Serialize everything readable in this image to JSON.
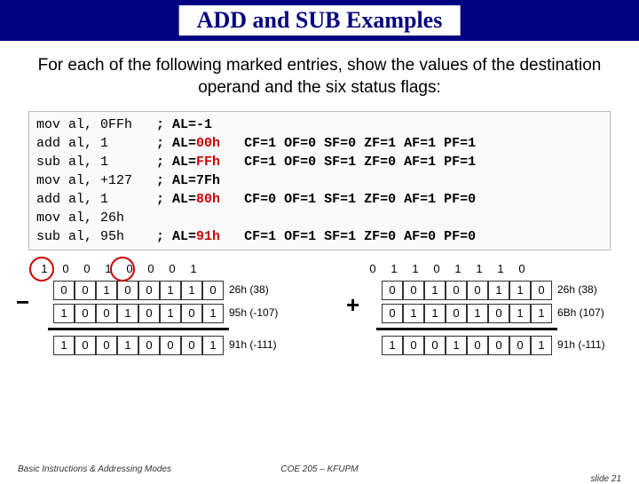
{
  "title": "ADD and SUB Examples",
  "subtitle": "For each of the following marked entries, show the values of the destination operand and the six status flags:",
  "code": [
    {
      "instr": "mov al, 0FFh",
      "comment": "; AL=-1",
      "flags": ""
    },
    {
      "instr": "add al, 1",
      "comment": "; AL=",
      "res": "00h",
      "flags": "   CF=1 OF=0 SF=0 ZF=1 AF=1 PF=1"
    },
    {
      "instr": "sub al, 1",
      "comment": "; AL=",
      "res": "FFh",
      "flags": "   CF=1 OF=0 SF=1 ZF=0 AF=1 PF=1"
    },
    {
      "instr": "mov al, +127",
      "comment": "; AL=7Fh",
      "flags": ""
    },
    {
      "instr": "add al, 1",
      "comment": "; AL=",
      "res": "80h",
      "flags": "   CF=0 OF=1 SF=1 ZF=0 AF=1 PF=0"
    },
    {
      "instr": "mov al, 26h",
      "comment": "",
      "flags": ""
    },
    {
      "instr": "sub al, 95h",
      "comment": "; AL=",
      "res": "91h",
      "flags": "   CF=1 OF=1 SF=1 ZF=0 AF=0 PF=0"
    }
  ],
  "left_calc": {
    "borrow": [
      "1",
      "0",
      "0",
      "1",
      "0",
      "0",
      "0",
      "1"
    ],
    "a": [
      "0",
      "0",
      "1",
      "0",
      "0",
      "1",
      "1",
      "0"
    ],
    "b": [
      "1",
      "0",
      "0",
      "1",
      "0",
      "1",
      "0",
      "1"
    ],
    "r": [
      "1",
      "0",
      "0",
      "1",
      "0",
      "0",
      "0",
      "1"
    ],
    "a_lbl": "26h (38)",
    "b_lbl": "95h (-107)",
    "r_lbl": "91h (-111)",
    "op": "−"
  },
  "right_calc": {
    "carry": [
      "0",
      "1",
      "1",
      "0",
      "1",
      "1",
      "1",
      "0"
    ],
    "a": [
      "0",
      "0",
      "1",
      "0",
      "0",
      "1",
      "1",
      "0"
    ],
    "b": [
      "0",
      "1",
      "1",
      "0",
      "1",
      "0",
      "1",
      "1"
    ],
    "r": [
      "1",
      "0",
      "0",
      "1",
      "0",
      "0",
      "0",
      "1"
    ],
    "a_lbl": "26h (38)",
    "b_lbl": "6Bh (107)",
    "r_lbl": "91h (-111)",
    "op": "+"
  },
  "footer": {
    "left": "Basic Instructions & Addressing Modes",
    "center": "COE 205 – KFUPM",
    "right": "slide 21"
  }
}
